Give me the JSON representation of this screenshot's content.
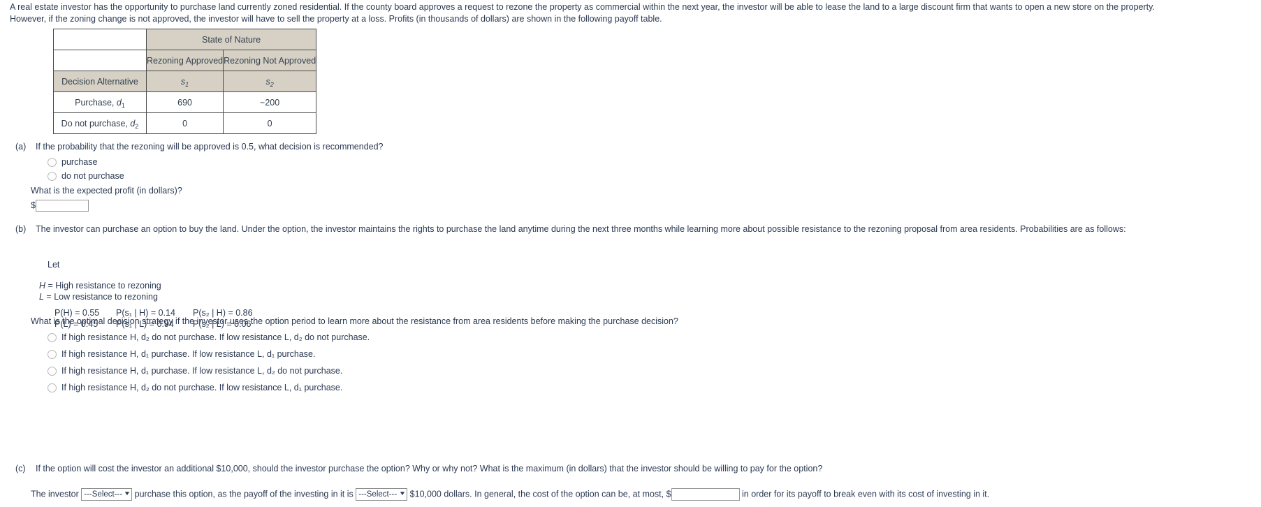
{
  "intro": {
    "line1": "A real estate investor has the opportunity to purchase land currently zoned residential. If the county board approves a request to rezone the property as commercial within the next year, the investor will be able to lease the land to a large discount firm that wants to open a new store on the property.",
    "line2": "However, if the zoning change is not approved, the investor will have to sell the property at a loss. Profits (in thousands of dollars) are shown in the following payoff table."
  },
  "table": {
    "state_of_nature": "State of Nature",
    "col_headers": [
      "Rezoning Approved",
      "Rezoning Not Approved"
    ],
    "symbol_row_label": "Decision Alternative",
    "symbols": [
      "s",
      "s"
    ],
    "symbol_subs": [
      "1",
      "2"
    ],
    "rows": [
      {
        "label_text": "Purchase, ",
        "label_var": "d",
        "label_sub": "1",
        "values": [
          "690",
          "−200"
        ]
      },
      {
        "label_text": "Do not purchase, ",
        "label_var": "d",
        "label_sub": "2",
        "values": [
          "0",
          "0"
        ]
      }
    ],
    "header_bg": "#d6d1c4",
    "border_color": "#4a4a4a"
  },
  "part_a": {
    "label": "(a)",
    "question": "If the probability that the rezoning will be approved is 0.5, what decision is recommended?",
    "options": [
      "purchase",
      "do not purchase"
    ],
    "profit_question": "What is the expected profit (in dollars)?",
    "dollar_sign": "$",
    "input_value": ""
  },
  "part_b": {
    "label": "(b)",
    "question": "The investor can purchase an option to buy the land. Under the option, the investor maintains the rights to purchase the land anytime during the next three months while learning more about possible resistance to the rezoning proposal from area residents. Probabilities are as follows:",
    "let_label": "Let",
    "definitions": [
      {
        "var": "H",
        "text": " = High resistance to rezoning"
      },
      {
        "var": "L",
        "text": " = Low resistance to rezoning"
      }
    ],
    "prob_rows": [
      {
        "c1": "P(H) = 0.55",
        "c2": "P(s₁ | H) = 0.14",
        "c3": "P(s₂ | H) = 0.86"
      },
      {
        "c1": "P(L) = 0.45",
        "c2": "P(s₁ | L) = 0.94",
        "c3": "P(s₂ | L) = 0.06"
      }
    ],
    "strategy_question": "What is the optimal decision strategy if the investor uses the option period to learn more about the resistance from area residents before making the purchase decision?",
    "options": [
      "If high resistance H, d₂ do not purchase. If low resistance L, d₂ do not purchase.",
      "If high resistance H, d₁ purchase. If low resistance L, d₁ purchase.",
      "If high resistance H, d₁ purchase. If low resistance L, d₂ do not purchase.",
      "If high resistance H, d₂ do not purchase. If low resistance L, d₁ purchase."
    ]
  },
  "part_c": {
    "label": "(c)",
    "question": "If the option will cost the investor an additional $10,000, should the investor purchase the option? Why or why not? What is the maximum (in dollars) that the investor should be willing to pay for the option?",
    "sentence_1": "The investor",
    "select_1": "---Select---",
    "sentence_2": "purchase this option, as the payoff of the investing in it is",
    "select_2": "---Select---",
    "sentence_3": "$10,000 dollars. In general, the cost of the option can be, at most, $",
    "input_value": "",
    "sentence_4": "in order for its payoff to break even with its cost of investing in it.",
    "dropdown_arrow": "chevron-down-icon"
  }
}
